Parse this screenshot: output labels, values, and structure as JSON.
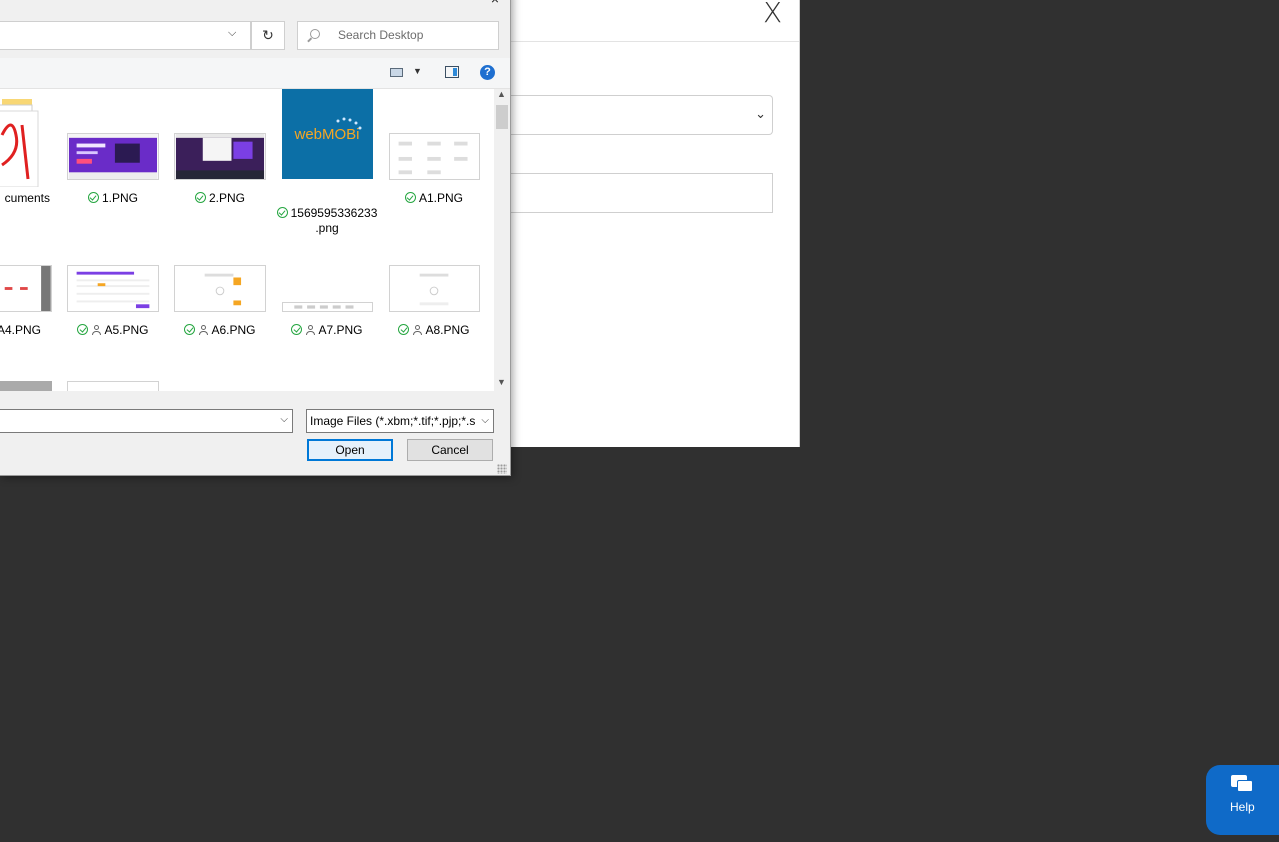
{
  "modal": {
    "close_label": "X"
  },
  "dialog": {
    "title_close": "×",
    "address_dropdown": "⌵",
    "refresh_label": "↻",
    "search": {
      "placeholder": "Search Desktop"
    },
    "toolbar": {
      "help_label": "?"
    },
    "files": [
      {
        "name": "cuments",
        "status": "",
        "kind": "pdf"
      },
      {
        "name": "1.PNG",
        "status": "synced",
        "kind": "purple-site"
      },
      {
        "name": "2.PNG",
        "status": "synced",
        "kind": "dark-site"
      },
      {
        "name": "1569595336233\n.png",
        "status": "synced",
        "kind": "webmobi",
        "logo_text": "webMOBi"
      },
      {
        "name": "A1.PNG",
        "status": "synced",
        "kind": "white-site"
      },
      {
        "name": "A4.PNG",
        "status": "",
        "kind": "white-site"
      },
      {
        "name": "A5.PNG",
        "status": "synced-shared",
        "kind": "white-site"
      },
      {
        "name": "A6.PNG",
        "status": "synced-shared",
        "kind": "white-site"
      },
      {
        "name": "A7.PNG",
        "status": "synced-shared",
        "kind": "white-site"
      },
      {
        "name": "A8.PNG",
        "status": "synced-shared",
        "kind": "white-site"
      }
    ],
    "filetype_value": "Image Files (*.xbm;*.tif;*.pjp;*.s",
    "open_label": "Open",
    "cancel_label": "Cancel"
  },
  "help_widget": {
    "label": "Help"
  },
  "colors": {
    "accent": "#0078d7",
    "sync_ok": "#26a641",
    "help_bg": "#0f6ac8",
    "page_bg": "#303030"
  }
}
